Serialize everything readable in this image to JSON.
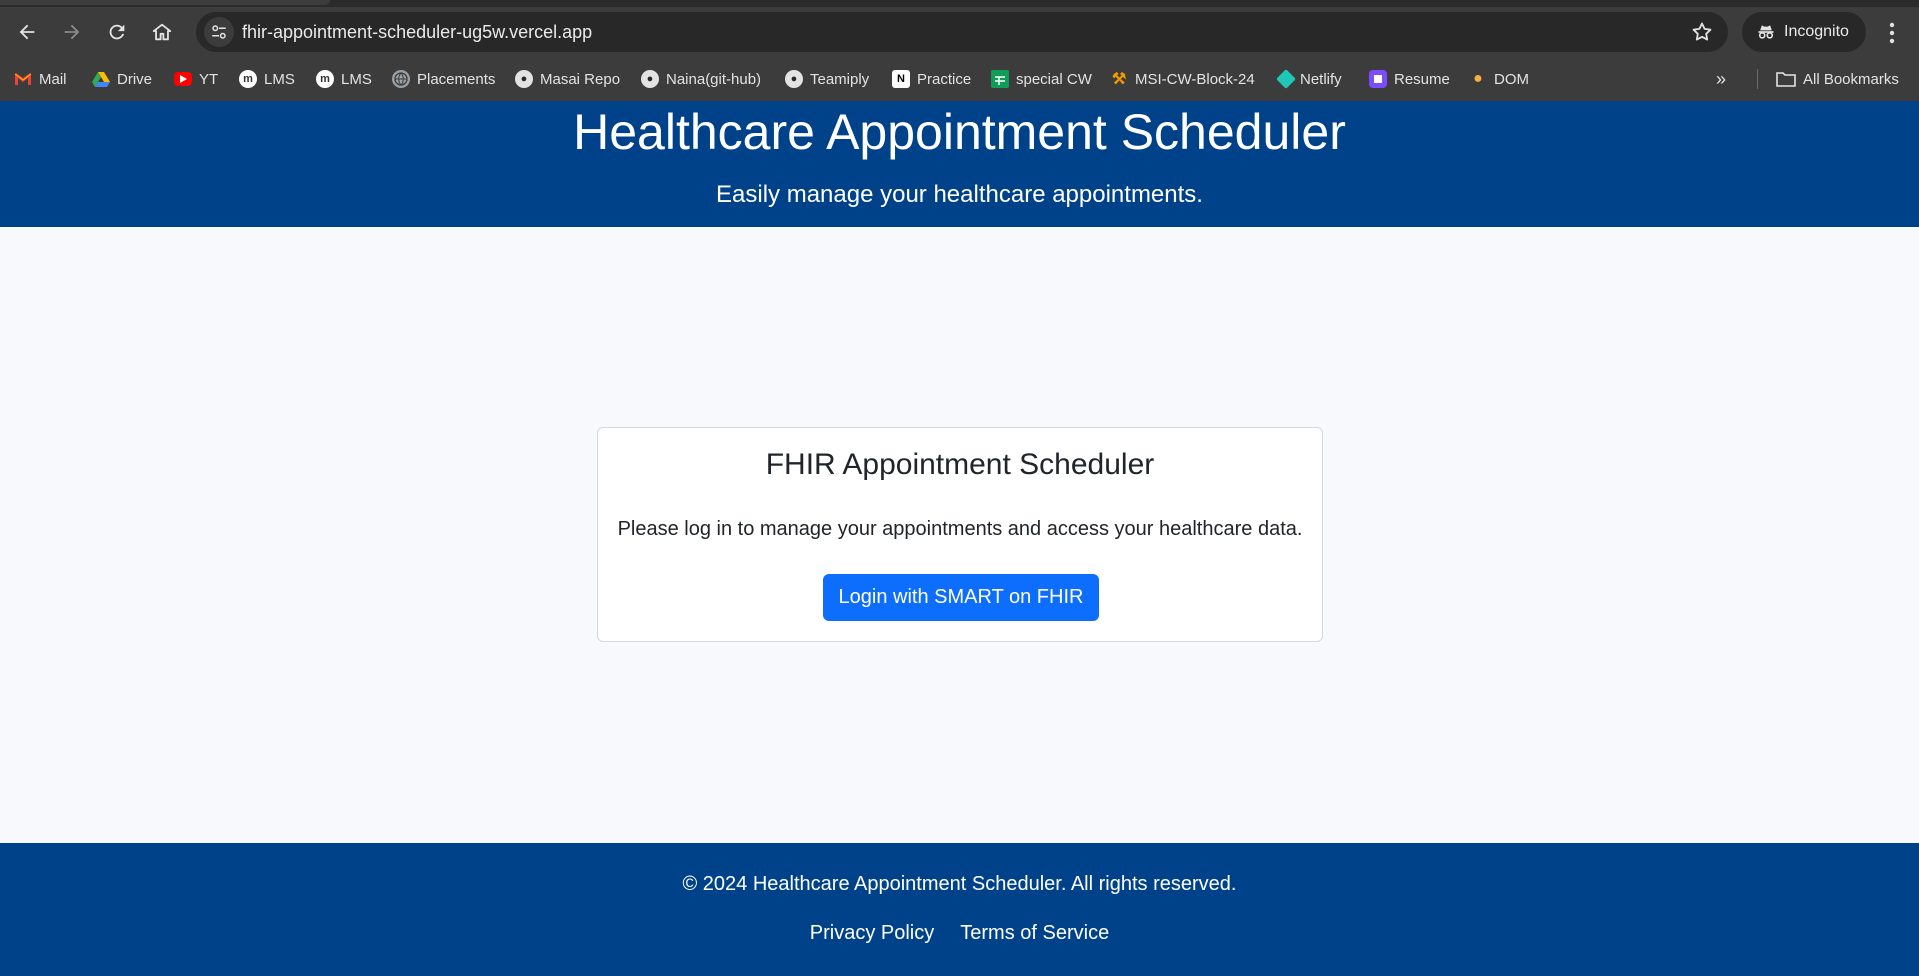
{
  "browser": {
    "url": "fhir-appointment-scheduler-ug5w.vercel.app",
    "incognito_label": "Incognito",
    "all_bookmarks_label": "All Bookmarks",
    "bookmarks": [
      {
        "label": "Mail",
        "icon": "gmail-icon"
      },
      {
        "label": "Drive",
        "icon": "drive-icon"
      },
      {
        "label": "YT",
        "icon": "youtube-icon"
      },
      {
        "label": "LMS",
        "icon": "masai-icon"
      },
      {
        "label": "LMS",
        "icon": "masai-icon"
      },
      {
        "label": "Placements",
        "icon": "globe-icon"
      },
      {
        "label": "Masai Repo",
        "icon": "github-icon"
      },
      {
        "label": "Naina(git-hub)",
        "icon": "github-icon"
      },
      {
        "label": "Teamiply",
        "icon": "github-icon"
      },
      {
        "label": "Practice",
        "icon": "notion-icon"
      },
      {
        "label": "special CW",
        "icon": "sheets-icon"
      },
      {
        "label": "MSI-CW-Block-24",
        "icon": "tools-icon"
      },
      {
        "label": "Netlify",
        "icon": "netlify-icon"
      },
      {
        "label": "Resume",
        "icon": "resume-icon"
      },
      {
        "label": "DOM",
        "icon": "person-icon"
      }
    ]
  },
  "header": {
    "title": "Healthcare Appointment Scheduler",
    "subtitle": "Easily manage your healthcare appointments."
  },
  "card": {
    "title": "FHIR Appointment Scheduler",
    "message": "Please log in to manage your appointments and access your healthcare data.",
    "login_label": "Login with SMART on FHIR"
  },
  "footer": {
    "copyright": "© 2024 Healthcare Appointment Scheduler. All rights reserved.",
    "links": [
      "Privacy Policy",
      "Terms of Service"
    ]
  },
  "colors": {
    "header_bg": "#00428a",
    "button_bg": "#0d6efd",
    "page_bg": "#f7f9fc"
  }
}
